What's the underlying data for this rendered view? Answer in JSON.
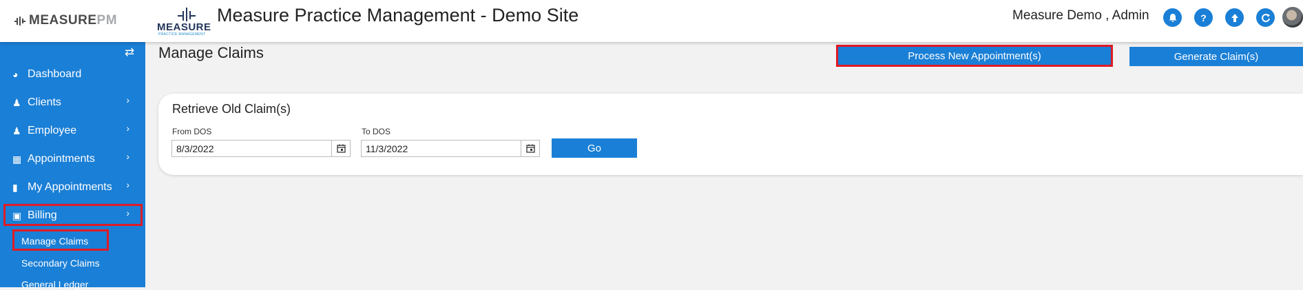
{
  "header": {
    "brand_left": "MEASURE",
    "brand_right": "PM",
    "logo_word": "MEASURE",
    "logo_sub": "PRACTICE MANAGEMENT",
    "title": "Measure Practice Management - Demo Site",
    "user": "Measure Demo , Admin",
    "icons": [
      "bell-icon",
      "help-icon",
      "upload-icon",
      "refresh-icon"
    ]
  },
  "sidebar": {
    "items": [
      {
        "label": "Dashboard",
        "icon": "dashboard-icon"
      },
      {
        "label": "Clients",
        "icon": "user-icon"
      },
      {
        "label": "Employee",
        "icon": "users-icon"
      },
      {
        "label": "Appointments",
        "icon": "calendar-icon"
      },
      {
        "label": "My Appointments",
        "icon": "tablet-icon"
      },
      {
        "label": "Billing",
        "icon": "money-icon"
      }
    ],
    "subitems": [
      "Manage Claims",
      "Secondary Claims",
      "General Ledger"
    ]
  },
  "main": {
    "page_title": "Manage Claims",
    "process_button": "Process New Appointment(s)",
    "generate_button": "Generate Claim(s)",
    "retrieve": {
      "title": "Retrieve Old Claim(s)",
      "from_label": "From DOS",
      "from_value": "8/3/2022",
      "to_label": "To DOS",
      "to_value": "11/3/2022",
      "go_label": "Go"
    }
  },
  "colors": {
    "primary": "#1a7fd6",
    "highlight": "#e01b24",
    "background": "#f2f2f2"
  }
}
